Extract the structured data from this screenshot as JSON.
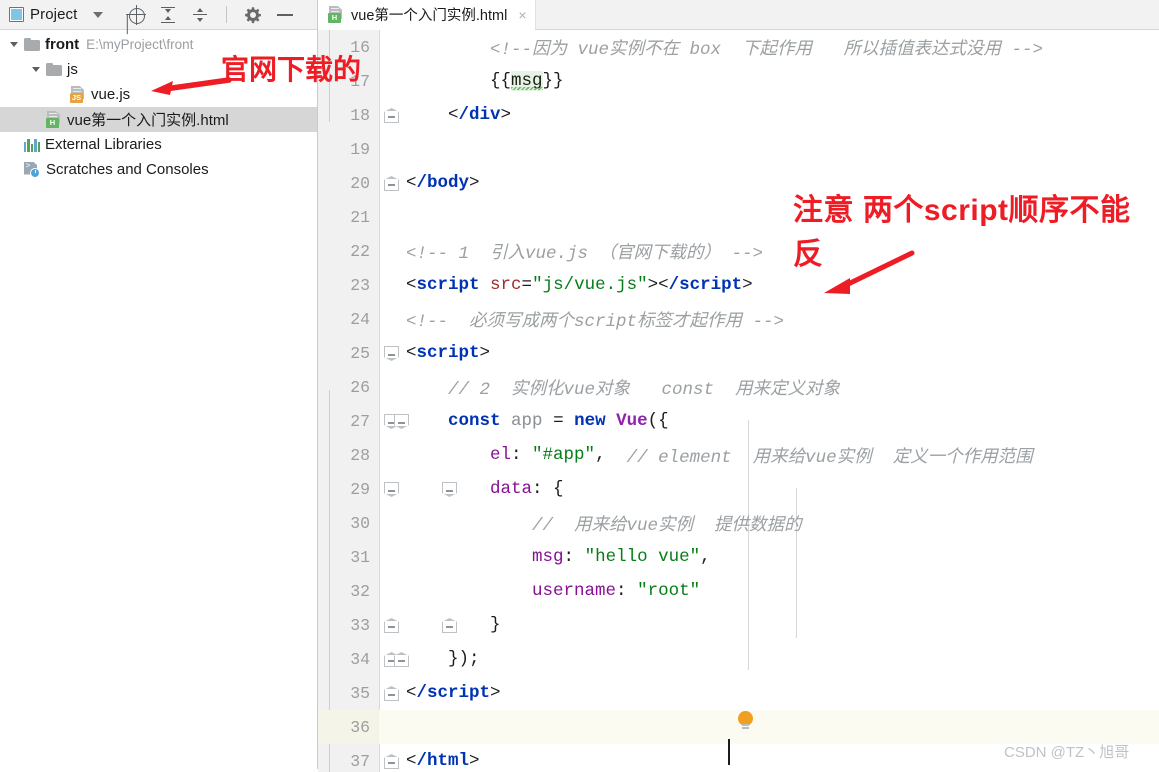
{
  "project_panel": {
    "title": "Project",
    "icons": [
      "project-window-icon",
      "chevron-down-icon",
      "locate-icon",
      "expand-all-icon",
      "collapse-all-icon",
      "settings-gear-icon",
      "minimize-icon"
    ],
    "tree": [
      {
        "label": "front",
        "path": "E:\\myProject\\front",
        "icon": "folder-icon",
        "indent": 0,
        "expanded": true,
        "selected": false
      },
      {
        "label": "js",
        "path": "",
        "icon": "folder-icon",
        "indent": 1,
        "expanded": true,
        "selected": false
      },
      {
        "label": "vue.js",
        "path": "",
        "icon": "js-file-icon",
        "badge": "JS",
        "indent": 2,
        "expanded": false,
        "selected": false
      },
      {
        "label": "vue第一个入门实例.html",
        "path": "",
        "icon": "html-file-icon",
        "badge": "H",
        "indent": 1,
        "expanded": false,
        "selected": true
      },
      {
        "label": "External Libraries",
        "path": "",
        "icon": "libraries-icon",
        "indent": 0,
        "expanded": false,
        "selected": false
      },
      {
        "label": "Scratches and Consoles",
        "path": "",
        "icon": "scratches-icon",
        "indent": 0,
        "expanded": false,
        "selected": false
      }
    ]
  },
  "editor": {
    "tab": {
      "label": "vue第一个入门实例.html",
      "icon": "html-file-icon",
      "close": "×"
    },
    "caret_line": 36,
    "lines": [
      {
        "num": 16,
        "segments": [
          {
            "text": "        ",
            "type": "plain"
          },
          {
            "text": "<!--因为 vue实例不在 box  下起作用   所以插值表达式没用 -->",
            "type": "comment"
          }
        ]
      },
      {
        "num": 17,
        "segments": [
          {
            "text": "        ",
            "type": "plain"
          },
          {
            "text": "{{",
            "type": "punct"
          },
          {
            "text": "msg",
            "type": "highlight"
          },
          {
            "text": "}}",
            "type": "punct"
          }
        ]
      },
      {
        "num": 18,
        "segments": [
          {
            "text": "    ",
            "type": "plain"
          },
          {
            "text": "<",
            "type": "punct"
          },
          {
            "text": "/div",
            "type": "tag"
          },
          {
            "text": ">",
            "type": "punct"
          }
        ]
      },
      {
        "num": 19,
        "segments": []
      },
      {
        "num": 20,
        "segments": [
          {
            "text": "",
            "type": "plain"
          },
          {
            "text": "<",
            "type": "punct"
          },
          {
            "text": "/body",
            "type": "tag"
          },
          {
            "text": ">",
            "type": "punct"
          }
        ]
      },
      {
        "num": 21,
        "segments": []
      },
      {
        "num": 22,
        "segments": [
          {
            "text": "",
            "type": "plain"
          },
          {
            "text": "<!-- 1  引入vue.js （官网下载的） -->",
            "type": "comment"
          }
        ]
      },
      {
        "num": 23,
        "segments": [
          {
            "text": "<",
            "type": "punct"
          },
          {
            "text": "script ",
            "type": "tag"
          },
          {
            "text": "src",
            "type": "attr"
          },
          {
            "text": "=",
            "type": "punct"
          },
          {
            "text": "\"js/vue.js\"",
            "type": "string"
          },
          {
            "text": ">",
            "type": "punct"
          },
          {
            "text": "<",
            "type": "punct"
          },
          {
            "text": "/script",
            "type": "tag"
          },
          {
            "text": ">",
            "type": "punct"
          }
        ]
      },
      {
        "num": 24,
        "segments": [
          {
            "text": "",
            "type": "plain"
          },
          {
            "text": "<!--  必须写成两个script标签才起作用 -->",
            "type": "comment"
          }
        ]
      },
      {
        "num": 25,
        "segments": [
          {
            "text": "<",
            "type": "punct"
          },
          {
            "text": "script",
            "type": "tag"
          },
          {
            "text": ">",
            "type": "punct"
          }
        ]
      },
      {
        "num": 26,
        "segments": [
          {
            "text": "    ",
            "type": "plain"
          },
          {
            "text": "// 2  实例化vue对象   const  用来定义对象",
            "type": "comment"
          }
        ]
      },
      {
        "num": 27,
        "segments": [
          {
            "text": "    ",
            "type": "plain"
          },
          {
            "text": "const",
            "type": "keyword"
          },
          {
            "text": " ",
            "type": "plain"
          },
          {
            "text": "app",
            "type": "variable"
          },
          {
            "text": " = ",
            "type": "plain"
          },
          {
            "text": "new",
            "type": "keyword"
          },
          {
            "text": " ",
            "type": "plain"
          },
          {
            "text": "Vue",
            "type": "class"
          },
          {
            "text": "({",
            "type": "punct"
          }
        ]
      },
      {
        "num": 28,
        "segments": [
          {
            "text": "        ",
            "type": "plain"
          },
          {
            "text": "el",
            "type": "property"
          },
          {
            "text": ": ",
            "type": "punct"
          },
          {
            "text": "\"#app\"",
            "type": "string"
          },
          {
            "text": ",  ",
            "type": "punct"
          },
          {
            "text": "// element  用来给vue实例  定义一个作用范围",
            "type": "comment"
          }
        ]
      },
      {
        "num": 29,
        "segments": [
          {
            "text": "        ",
            "type": "plain"
          },
          {
            "text": "data",
            "type": "property"
          },
          {
            "text": ": {",
            "type": "punct"
          }
        ]
      },
      {
        "num": 30,
        "segments": [
          {
            "text": "            ",
            "type": "plain"
          },
          {
            "text": "//  用来给vue实例  提供数据的",
            "type": "comment"
          }
        ]
      },
      {
        "num": 31,
        "segments": [
          {
            "text": "            ",
            "type": "plain"
          },
          {
            "text": "msg",
            "type": "property"
          },
          {
            "text": ": ",
            "type": "punct"
          },
          {
            "text": "\"hello vue\"",
            "type": "string"
          },
          {
            "text": ",",
            "type": "punct"
          }
        ]
      },
      {
        "num": 32,
        "segments": [
          {
            "text": "            ",
            "type": "plain"
          },
          {
            "text": "username",
            "type": "property"
          },
          {
            "text": ": ",
            "type": "punct"
          },
          {
            "text": "\"root\"",
            "type": "string"
          }
        ]
      },
      {
        "num": 33,
        "segments": [
          {
            "text": "        ",
            "type": "plain"
          },
          {
            "text": "}",
            "type": "punct"
          }
        ]
      },
      {
        "num": 34,
        "segments": [
          {
            "text": "    ",
            "type": "plain"
          },
          {
            "text": "});",
            "type": "punct"
          }
        ]
      },
      {
        "num": 35,
        "segments": [
          {
            "text": "<",
            "type": "punct"
          },
          {
            "text": "/script",
            "type": "tag"
          },
          {
            "text": ">",
            "type": "punct"
          }
        ]
      },
      {
        "num": 36,
        "segments": []
      },
      {
        "num": 37,
        "segments": [
          {
            "text": "<",
            "type": "punct"
          },
          {
            "text": "/html",
            "type": "tag"
          },
          {
            "text": ">",
            "type": "punct"
          }
        ]
      }
    ]
  },
  "annotations": {
    "note_1": "官网下载的",
    "note_2": "注意 两个script顺序不能反",
    "color": "#ee1c25",
    "arrows": [
      "arrow-pointing-to-vuejs",
      "arrow-pointing-to-script-tag"
    ]
  },
  "watermark": "CSDN @TZ丶旭哥"
}
